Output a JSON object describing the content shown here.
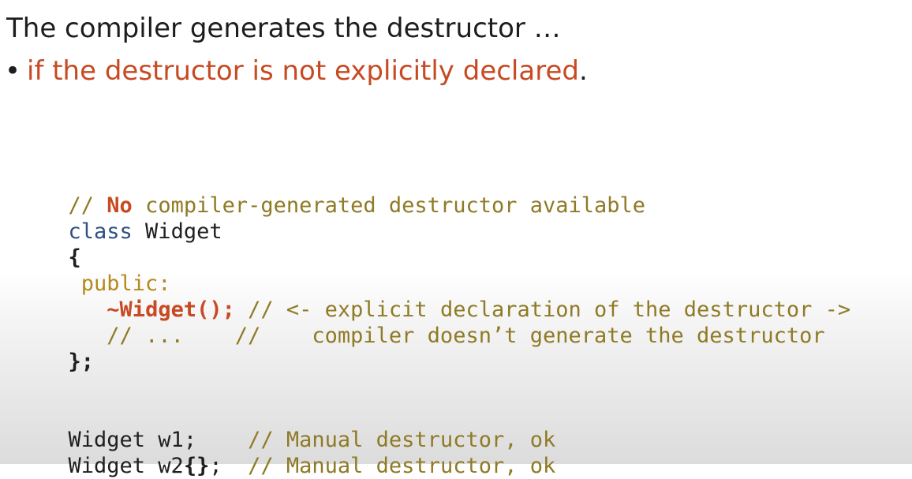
{
  "title": "The compiler generates the destructor …",
  "bullet": {
    "symbol": "•",
    "text": "if the destructor is not explicitly declared",
    "suffix": "."
  },
  "code": {
    "line1": {
      "comment_prefix": "// ",
      "highlight": "No",
      "comment_suffix": " compiler-generated destructor available"
    },
    "line2": {
      "keyword": "class",
      "identifier": " Widget"
    },
    "line3": {
      "text": "{"
    },
    "line4": {
      "text": " public:"
    },
    "line5": {
      "indent": "   ",
      "declaration": "~Widget();",
      "comment": " // <- explicit declaration of the destructor ->"
    },
    "line6": {
      "indent": "   ",
      "comment": "// ...    //    compiler doesn’t generate the destructor"
    },
    "line7": {
      "text": "};"
    },
    "line8": {
      "code": "Widget w1;",
      "comment": "    // Manual destructor, ok"
    },
    "line9": {
      "code_prefix": "Widget w2",
      "braces": "{}",
      "code_suffix": ";",
      "comment": "  // Manual destructor, ok"
    }
  },
  "colors": {
    "heading": "#1d1d1d",
    "accent_red": "#c74a22",
    "comment": "#8f7a25",
    "keyword": "#2d4f86",
    "access": "#b38a1d"
  }
}
